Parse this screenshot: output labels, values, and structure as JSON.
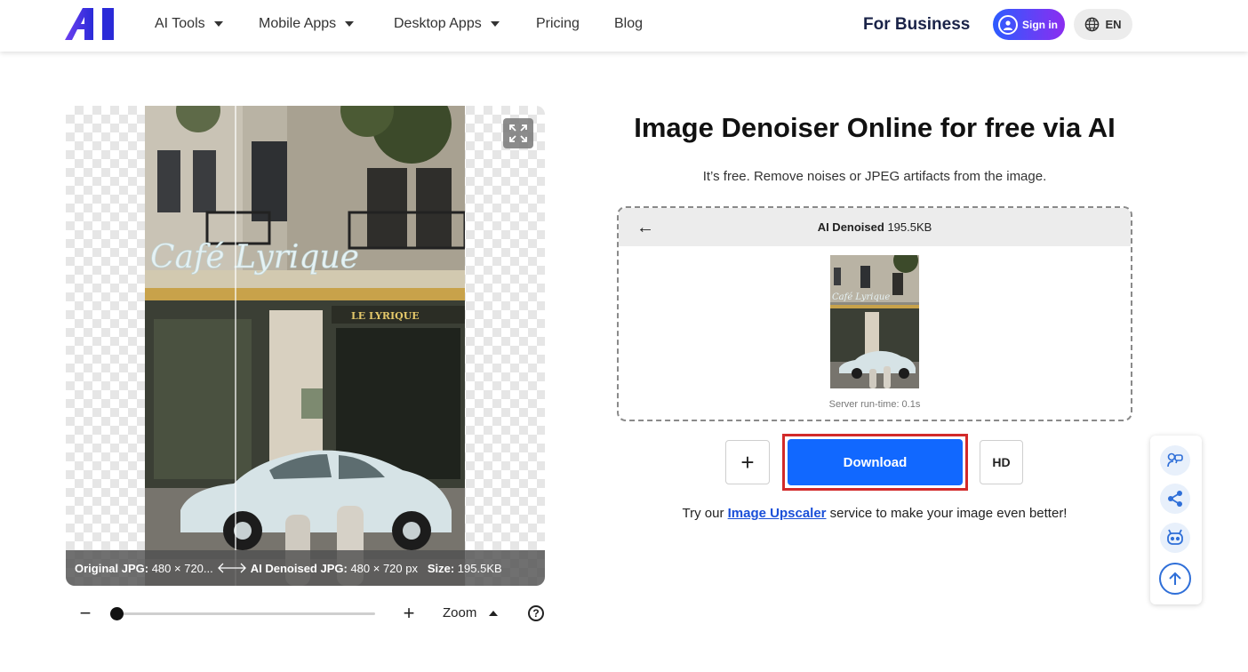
{
  "header": {
    "logo_text": "AI",
    "nav": [
      {
        "label": "AI Tools",
        "has_dropdown": true
      },
      {
        "label": "Mobile Apps",
        "has_dropdown": true
      },
      {
        "label": "Desktop Apps",
        "has_dropdown": true
      },
      {
        "label": "Pricing",
        "has_dropdown": false
      },
      {
        "label": "Blog",
        "has_dropdown": false
      }
    ],
    "for_business": "For Business",
    "sign_in": "Sign in",
    "language": "EN"
  },
  "preview": {
    "photo_sign_text": "Café Lyrique",
    "shop_sign_text": "LE LYRIQUE",
    "original_label": "Original JPG:",
    "original_value": "480 × 720...",
    "denoised_label": "AI Denoised JPG:",
    "denoised_value": "480 × 720 px",
    "size_label": "Size:",
    "size_value": "195.5KB"
  },
  "zoom": {
    "label": "Zoom",
    "minus": "−",
    "plus": "+",
    "help": "?",
    "level": 0.0
  },
  "main": {
    "title": "Image Denoiser Online for free via AI",
    "subtitle": "It’s free. Remove noises or JPEG artifacts from the image.",
    "result": {
      "back": "←",
      "title_bold": "AI Denoised",
      "size": "195.5KB",
      "runtime": "Server run-time: 0.1s"
    },
    "add_button": "+",
    "download_button": "Download",
    "hd_button": "HD",
    "tip_prefix": "Try our ",
    "tip_link": "Image Upscaler",
    "tip_suffix": " service to make your image even better!"
  },
  "colors": {
    "accent": "#1168ff",
    "highlight_frame": "#d22a2a",
    "brand_dark": "#1a2348",
    "signin_gradient_start": "#2d5cff",
    "signin_gradient_end": "#8b2df0"
  },
  "icons": {
    "side": [
      "feedback-icon",
      "share-icon",
      "robot-icon",
      "arrow-up-icon"
    ]
  }
}
